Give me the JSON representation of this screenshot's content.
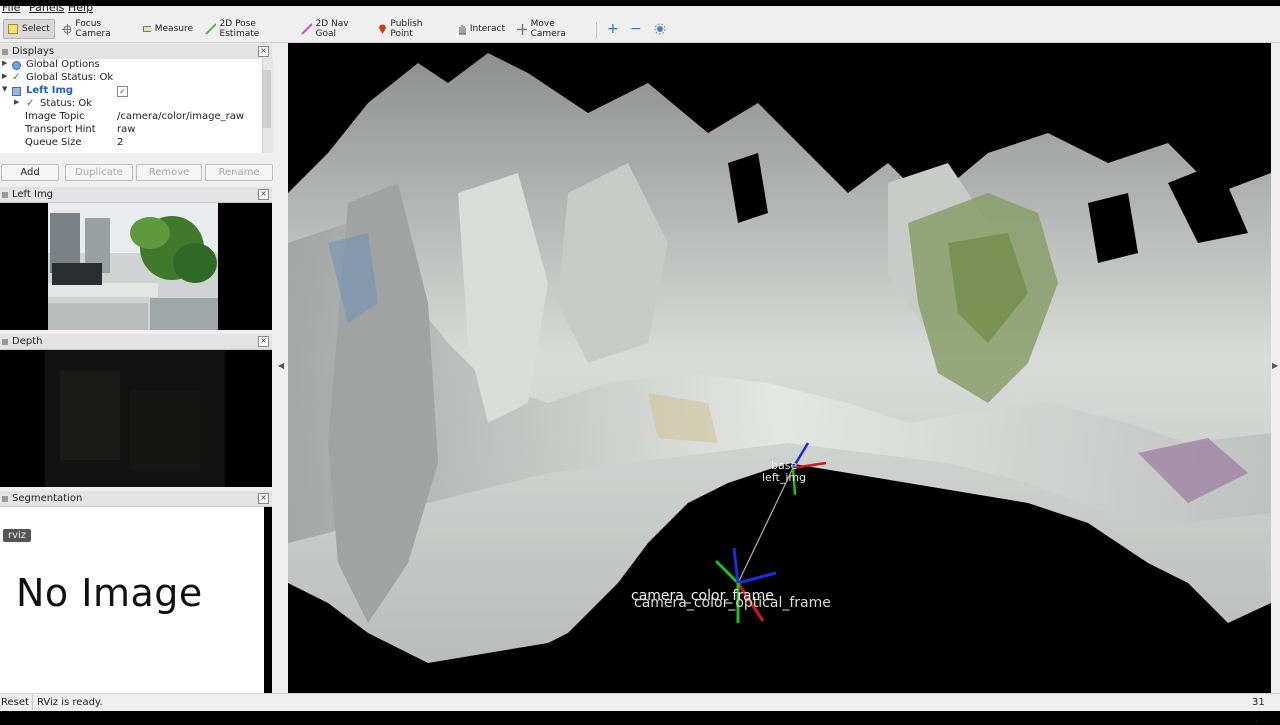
{
  "menu": [
    "File",
    "Panels",
    "Help"
  ],
  "toolbar": {
    "select": "Select",
    "focus_camera": "Focus Camera",
    "measure": "Measure",
    "pose_estimate": "2D Pose Estimate",
    "nav_goal": "2D Nav Goal",
    "publish_point": "Publish Point",
    "interact": "Interact",
    "move_camera": "Move Camera",
    "plus": "+",
    "minus": "−"
  },
  "displays": {
    "title": "Displays",
    "rows": [
      {
        "label": "Global Options",
        "value": ""
      },
      {
        "label": "Global Status: Ok",
        "value": ""
      },
      {
        "label": "Left Img",
        "value": "✓"
      },
      {
        "label": "Status: Ok",
        "value": ""
      },
      {
        "label": "Image Topic",
        "value": "/camera/color/image_raw"
      },
      {
        "label": "Transport Hint",
        "value": "raw"
      },
      {
        "label": "Queue Size",
        "value": "2"
      }
    ],
    "buttons": {
      "add": "Add",
      "duplicate": "Duplicate",
      "remove": "Remove",
      "rename": "Rename"
    }
  },
  "panels": {
    "left_img": "Left Img",
    "depth": "Depth",
    "segmentation": "Segmentation",
    "tooltip": "rviz",
    "no_image": "No Image"
  },
  "viewport": {
    "frame_label_top": "base",
    "frame_label_top2": "left_img",
    "frame_label_bottom": "camera_color_frame",
    "frame_label_bottom2": "camera_color_optical_frame"
  },
  "status": {
    "reset": "Reset",
    "message": "RViz is ready.",
    "fps": "31 fps"
  },
  "colors": {
    "panel_bg": "#efefef",
    "axis_x": "#d01818",
    "axis_y": "#1ec01e",
    "axis_z": "#1a2ee0",
    "link_blue": "#1b5fc9"
  }
}
